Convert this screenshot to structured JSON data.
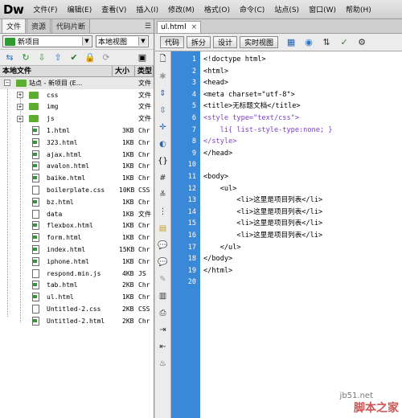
{
  "app": {
    "logo": "Dw"
  },
  "menu": [
    "文件(F)",
    "编辑(E)",
    "查看(V)",
    "插入(I)",
    "修改(M)",
    "格式(O)",
    "命令(C)",
    "站点(S)",
    "窗口(W)",
    "帮助(H)"
  ],
  "panel": {
    "tabs": [
      "文件",
      "资源",
      "代码片断"
    ],
    "site_select": "新项目",
    "view_select": "本地视图",
    "columns": {
      "name": "本地文件",
      "size": "大小",
      "type": "类型"
    },
    "root": "站点 - 新项目 (E...",
    "root_type": "文件",
    "folders": [
      {
        "name": "css",
        "type": "文件"
      },
      {
        "name": "img",
        "type": "文件"
      },
      {
        "name": "js",
        "type": "文件"
      }
    ],
    "files": [
      {
        "name": "1.html",
        "size": "3KB",
        "type": "Chr"
      },
      {
        "name": "323.html",
        "size": "1KB",
        "type": "Chr"
      },
      {
        "name": "ajax.html",
        "size": "1KB",
        "type": "Chr"
      },
      {
        "name": "avalon.html",
        "size": "1KB",
        "type": "Chr"
      },
      {
        "name": "baike.html",
        "size": "1KB",
        "type": "Chr"
      },
      {
        "name": "boilerplate.css",
        "size": "10KB",
        "type": "CSS"
      },
      {
        "name": "bz.html",
        "size": "1KB",
        "type": "Chr"
      },
      {
        "name": "data",
        "size": "1KB",
        "type": "文件"
      },
      {
        "name": "flexbox.html",
        "size": "1KB",
        "type": "Chr"
      },
      {
        "name": "form.html",
        "size": "1KB",
        "type": "Chr"
      },
      {
        "name": "index.html",
        "size": "15KB",
        "type": "Chr"
      },
      {
        "name": "iphone.html",
        "size": "1KB",
        "type": "Chr"
      },
      {
        "name": "respond.min.js",
        "size": "4KB",
        "type": "JS"
      },
      {
        "name": "tab.html",
        "size": "2KB",
        "type": "Chr"
      },
      {
        "name": "ul.html",
        "size": "1KB",
        "type": "Chr"
      },
      {
        "name": "Untitled-2.css",
        "size": "2KB",
        "type": "CSS"
      },
      {
        "name": "Untitled-2.html",
        "size": "2KB",
        "type": "Chr"
      }
    ]
  },
  "document": {
    "tab_name": "ul.html",
    "close": "×",
    "views": [
      "代码",
      "拆分",
      "设计",
      "实时视图"
    ],
    "line_numbers": [
      "1",
      "2",
      "3",
      "4",
      "5",
      "6",
      "7",
      "8",
      "9",
      "10",
      "11",
      "12",
      "13",
      "14",
      "15",
      "16",
      "17",
      "18",
      "19",
      "20"
    ],
    "code_lines": [
      "<!doctype html>",
      "<html>",
      "<head>",
      "<meta charset=\"utf-8\">",
      "<title>无标题文档</title>",
      "<style type=\"text/css\">",
      "    li{ list-style-type:none; }",
      "</style>",
      "</head>",
      "",
      "<body>",
      "    <ul>",
      "        <li>这里是项目列表</li>",
      "        <li>这里是项目列表</li>",
      "        <li>这里是项目列表</li>",
      "        <li>这里是项目列表</li>",
      "    </ul>",
      "</body>",
      "</html>",
      ""
    ]
  },
  "watermark": {
    "site": "jb51.net",
    "brand": "脚本之家"
  }
}
